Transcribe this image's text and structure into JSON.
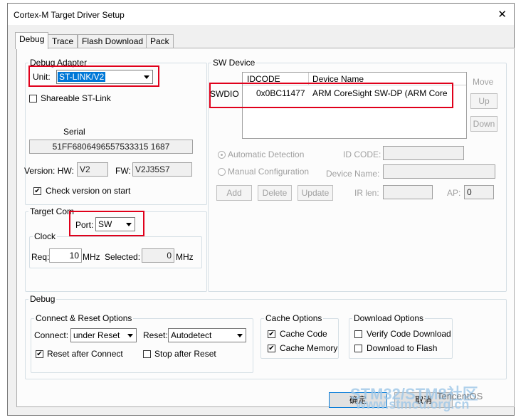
{
  "window": {
    "title": "Cortex-M Target Driver Setup",
    "close_glyph": "✕"
  },
  "tabs": [
    "Debug",
    "Trace",
    "Flash Download",
    "Pack"
  ],
  "debug_adapter": {
    "group": "Debug Adapter",
    "unit_label": "Unit:",
    "unit_value": "ST-LINK/V2",
    "shareable_label": "Shareable ST-Link",
    "shareable_checked": false,
    "serial_label": "Serial",
    "serial_value": "51FF6806496557533315 1687",
    "version_label": "Version: HW:",
    "hw_value": "V2",
    "fw_label": "FW:",
    "fw_value": "V2J35S7",
    "check_version_label": "Check version on start",
    "check_version_checked": true
  },
  "target_com": {
    "group": "Target Com",
    "port_label": "Port:",
    "port_value": "SW",
    "clock_group": "Clock",
    "req_label": "Req:",
    "req_value": "10",
    "mhz1": "MHz",
    "selected_label": "Selected:",
    "selected_value": "0",
    "mhz2": "MHz"
  },
  "sw_device": {
    "group": "SW Device",
    "col_idcode": "IDCODE",
    "col_name": "Device Name",
    "row_label": "SWDIO",
    "row_idcode": "0x0BC11477",
    "row_name": "ARM CoreSight SW-DP (ARM Core",
    "move_label": "Move",
    "up_btn": "Up",
    "down_btn": "Down",
    "auto_detect": "Automatic Detection",
    "manual_config": "Manual Configuration",
    "id_code_label": "ID CODE:",
    "device_name_label": "Device Name:",
    "add_btn": "Add",
    "delete_btn": "Delete",
    "update_btn": "Update",
    "ir_len_label": "IR len:",
    "ap_label": "AP:",
    "ap_value": "0"
  },
  "debug": {
    "group": "Debug",
    "connect_reset_group": "Connect & Reset Options",
    "connect_label": "Connect:",
    "connect_value": "under Reset",
    "reset_label": "Reset:",
    "reset_value": "Autodetect",
    "reset_after_connect": "Reset after Connect",
    "reset_after_connect_checked": true,
    "stop_after_reset": "Stop after Reset",
    "stop_after_reset_checked": false,
    "cache_group": "Cache Options",
    "cache_code": "Cache Code",
    "cache_code_checked": true,
    "cache_memory": "Cache Memory",
    "cache_memory_checked": true,
    "download_group": "Download Options",
    "verify_code": "Verify Code Download",
    "verify_code_checked": false,
    "download_flash": "Download to Flash",
    "download_flash_checked": false
  },
  "footer": {
    "ok_btn": "确定",
    "cancel_btn": "取消",
    "watermark_line1": "STM32/STM8社区",
    "watermark_line2": "www.stmcu.org.cn",
    "watermark_brand": "TencentOS"
  },
  "colors": {
    "highlight": "#e0001b",
    "selection": "#0078d7"
  }
}
